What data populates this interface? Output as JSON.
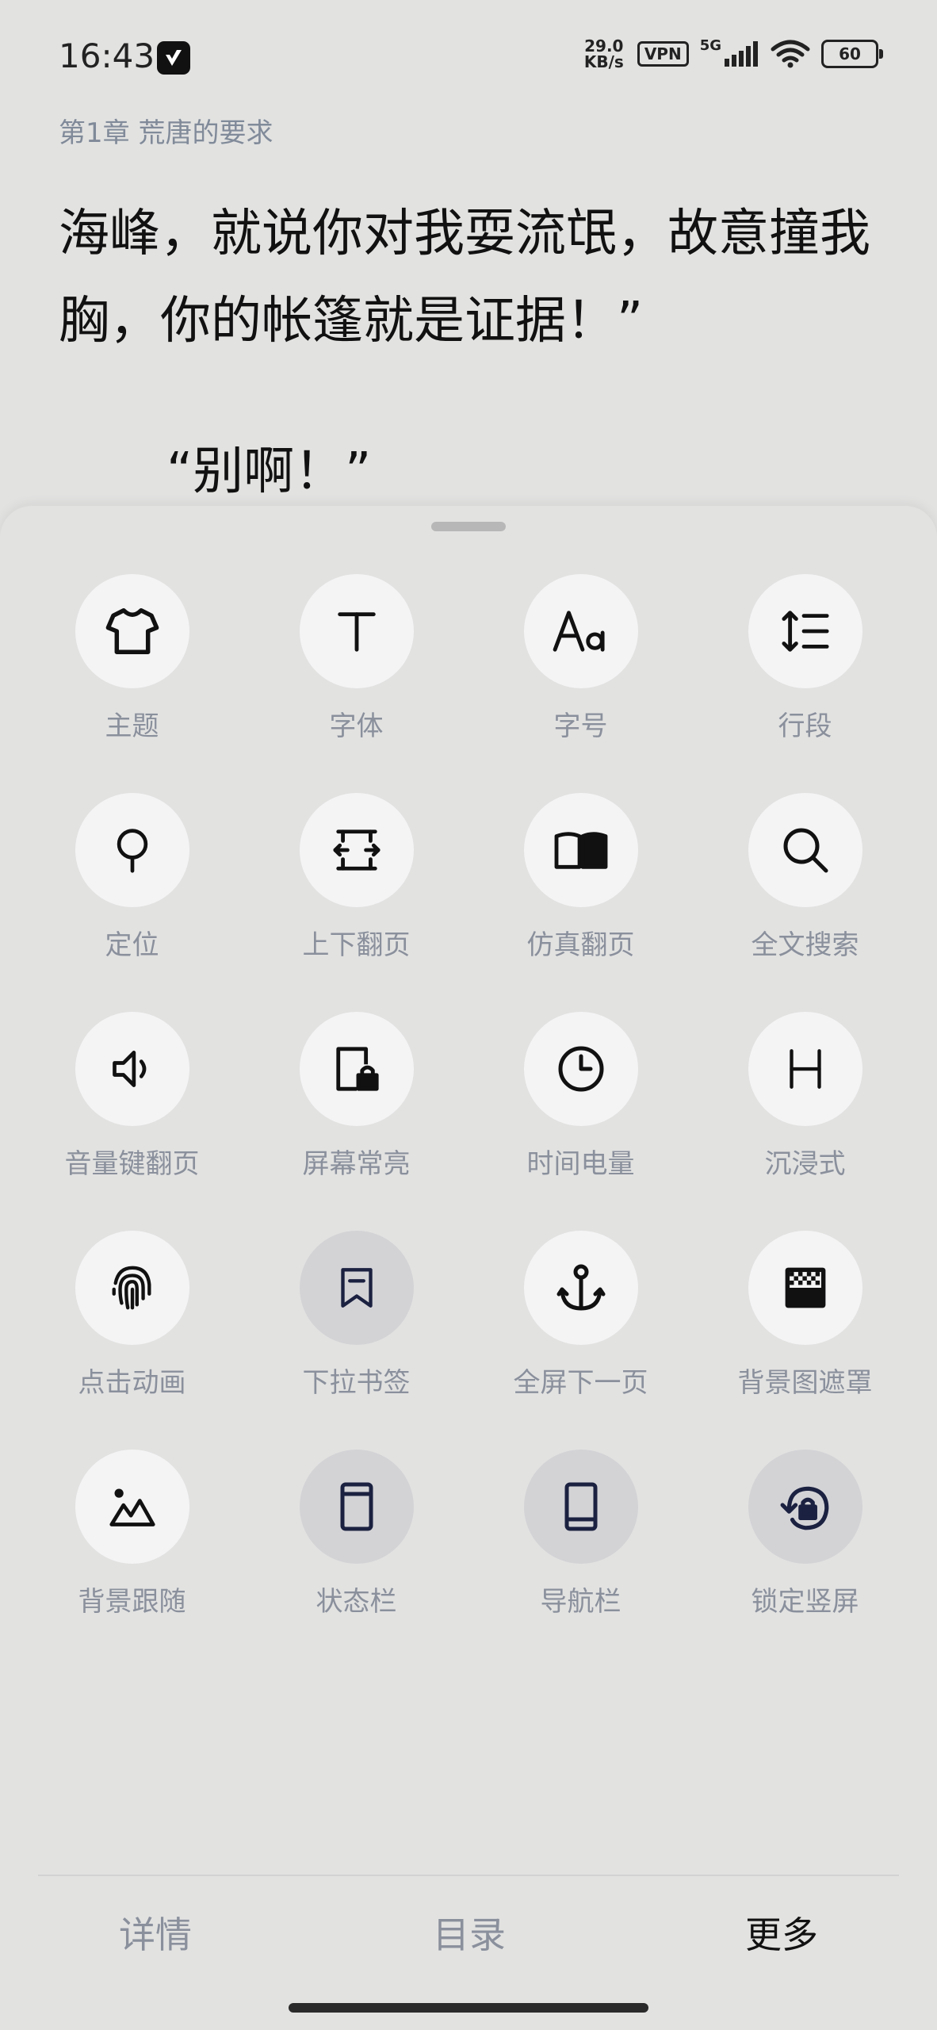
{
  "status": {
    "time": "16:43",
    "speed_value": "29.0",
    "speed_unit": "KB/s",
    "vpn": "VPN",
    "net": "5G",
    "battery": "60"
  },
  "reader": {
    "chapter": "第1章 荒唐的要求",
    "paragraph1": "海峰，就说你对我耍流氓，故意撞我胸，你的帐篷就是证据！”",
    "paragraph2": "“别啊！”"
  },
  "menu": {
    "items": [
      {
        "label": "主题",
        "icon": "tshirt-icon"
      },
      {
        "label": "字体",
        "icon": "font-t-icon"
      },
      {
        "label": "字号",
        "icon": "font-size-icon"
      },
      {
        "label": "行段",
        "icon": "line-spacing-icon"
      },
      {
        "label": "定位",
        "icon": "location-pin-icon"
      },
      {
        "label": "上下翻页",
        "icon": "vertical-page-icon"
      },
      {
        "label": "仿真翻页",
        "icon": "book-open-icon"
      },
      {
        "label": "全文搜索",
        "icon": "search-icon"
      },
      {
        "label": "音量键翻页",
        "icon": "volume-icon"
      },
      {
        "label": "屏幕常亮",
        "icon": "screen-lock-icon"
      },
      {
        "label": "时间电量",
        "icon": "clock-icon"
      },
      {
        "label": "沉浸式",
        "icon": "letter-h-icon"
      },
      {
        "label": "点击动画",
        "icon": "fingerprint-icon"
      },
      {
        "label": "下拉书签",
        "icon": "bookmark-icon"
      },
      {
        "label": "全屏下一页",
        "icon": "anchor-icon"
      },
      {
        "label": "背景图遮罩",
        "icon": "mask-pattern-icon"
      },
      {
        "label": "背景跟随",
        "icon": "landscape-icon"
      },
      {
        "label": "状态栏",
        "icon": "status-bar-icon"
      },
      {
        "label": "导航栏",
        "icon": "navigation-bar-icon"
      },
      {
        "label": "锁定竖屏",
        "icon": "rotate-lock-icon"
      }
    ]
  },
  "tabs": {
    "details": "详情",
    "catalog": "目录",
    "more": "更多"
  }
}
